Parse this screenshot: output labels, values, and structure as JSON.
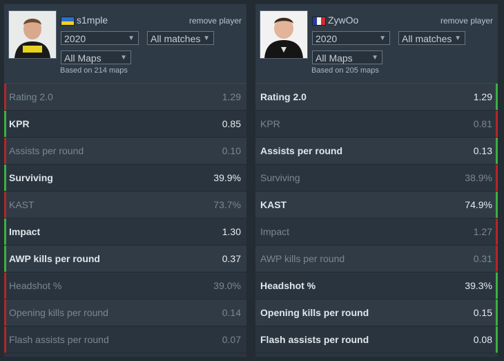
{
  "colors": {
    "win": "#3cb043",
    "lose": "#b3262b"
  },
  "players": [
    {
      "name": "s1mple",
      "flag_icon": "ukraine-flag-icon",
      "remove_label": "remove player",
      "year": "2020",
      "matches": "All matches",
      "maps": "All Maps",
      "based_on": "Based on 214 maps"
    },
    {
      "name": "ZywOo",
      "flag_icon": "france-flag-icon",
      "remove_label": "remove player",
      "year": "2020",
      "matches": "All matches",
      "maps": "All Maps",
      "based_on": "Based on 205 maps"
    }
  ],
  "stats": [
    {
      "label": "Rating 2.0",
      "values": [
        "1.29",
        "1.29"
      ],
      "winner": 1
    },
    {
      "label": "KPR",
      "values": [
        "0.85",
        "0.81"
      ],
      "winner": 0
    },
    {
      "label": "Assists per round",
      "values": [
        "0.10",
        "0.13"
      ],
      "winner": 1
    },
    {
      "label": "Surviving",
      "values": [
        "39.9%",
        "38.9%"
      ],
      "winner": 0
    },
    {
      "label": "KAST",
      "values": [
        "73.7%",
        "74.9%"
      ],
      "winner": 1
    },
    {
      "label": "Impact",
      "values": [
        "1.30",
        "1.27"
      ],
      "winner": 0
    },
    {
      "label": "AWP kills per round",
      "values": [
        "0.37",
        "0.31"
      ],
      "winner": 0
    },
    {
      "label": "Headshot %",
      "values": [
        "39.0%",
        "39.3%"
      ],
      "winner": 1
    },
    {
      "label": "Opening kills per round",
      "values": [
        "0.14",
        "0.15"
      ],
      "winner": 1
    },
    {
      "label": "Flash assists per round",
      "values": [
        "0.07",
        "0.08"
      ],
      "winner": 1
    }
  ]
}
